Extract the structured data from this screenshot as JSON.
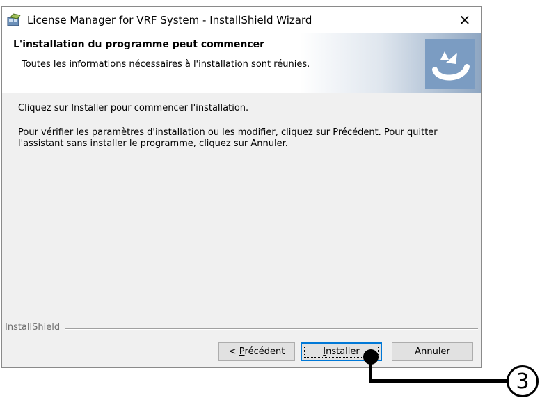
{
  "window": {
    "title": "License Manager for VRF System - InstallShield Wizard",
    "close_glyph": "✕"
  },
  "header": {
    "title": "L'installation du programme peut commencer",
    "subtitle": "Toutes les informations nécessaires à l'installation sont réunies.",
    "logo_icon": "installshield-logo-icon"
  },
  "body": {
    "line1": "Cliquez sur Installer pour commencer l'installation.",
    "line2": "Pour vérifier les paramètres d'installation ou les modifier, cliquez sur Précédent. Pour quitter l'assistant sans installer le programme, cliquez sur Annuler."
  },
  "footer": {
    "brand_label": "InstallShield"
  },
  "buttons": {
    "back_prefix": "< ",
    "back_mnemonic": "P",
    "back_rest": "récédent",
    "install_mnemonic": "I",
    "install_rest": "nstaller",
    "cancel_label": "Annuler"
  },
  "callout": {
    "label": "3"
  },
  "colors": {
    "focus_border": "#0078d7",
    "header_gradient_end": "#8ea6c2",
    "dialog_bg": "#f0f0f0"
  }
}
